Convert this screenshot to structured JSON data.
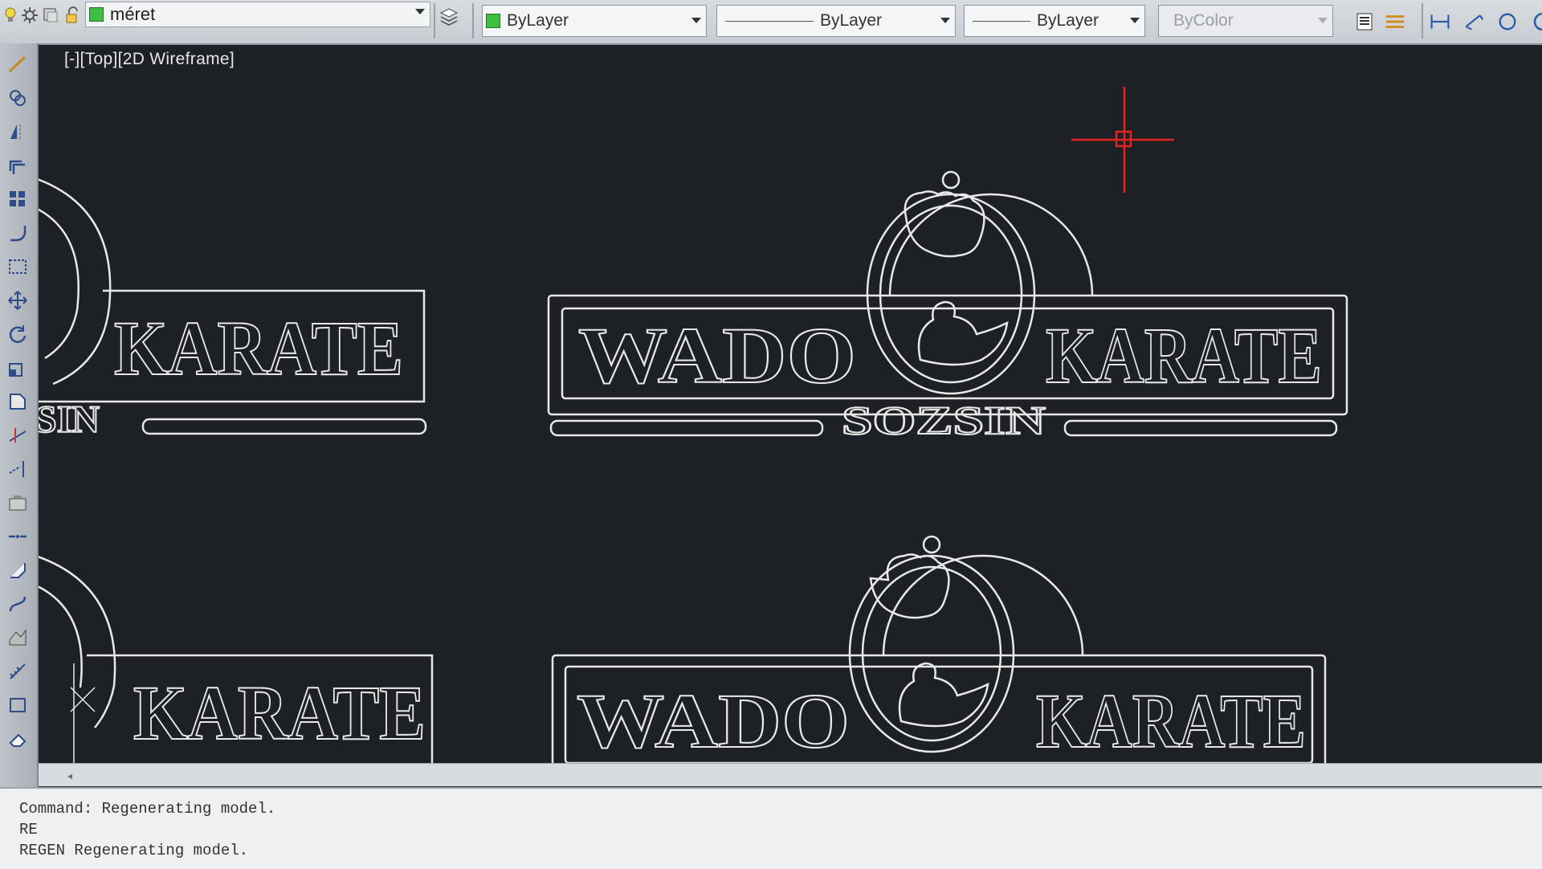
{
  "toolbar": {
    "layer_name": "méret",
    "color": "ByLayer",
    "linetype": "ByLayer",
    "lineweight": "ByLayer",
    "plot_style": "ByColor"
  },
  "viewport": {
    "label": "[-][Top][2D Wireframe]"
  },
  "drawing": {
    "left_word": "WADO",
    "right_word": "KARATE",
    "sub_word": "SOZSIN",
    "partial_sub_word": "SIN"
  },
  "command_line": {
    "lines": [
      "Command: Regenerating model.",
      "RE",
      "REGEN Regenerating model."
    ]
  },
  "colors": {
    "background": "#1d2126",
    "linework": "#e8e8e8",
    "crosshair": "#e0261f",
    "layer_swatch": "#3fbf3f"
  }
}
